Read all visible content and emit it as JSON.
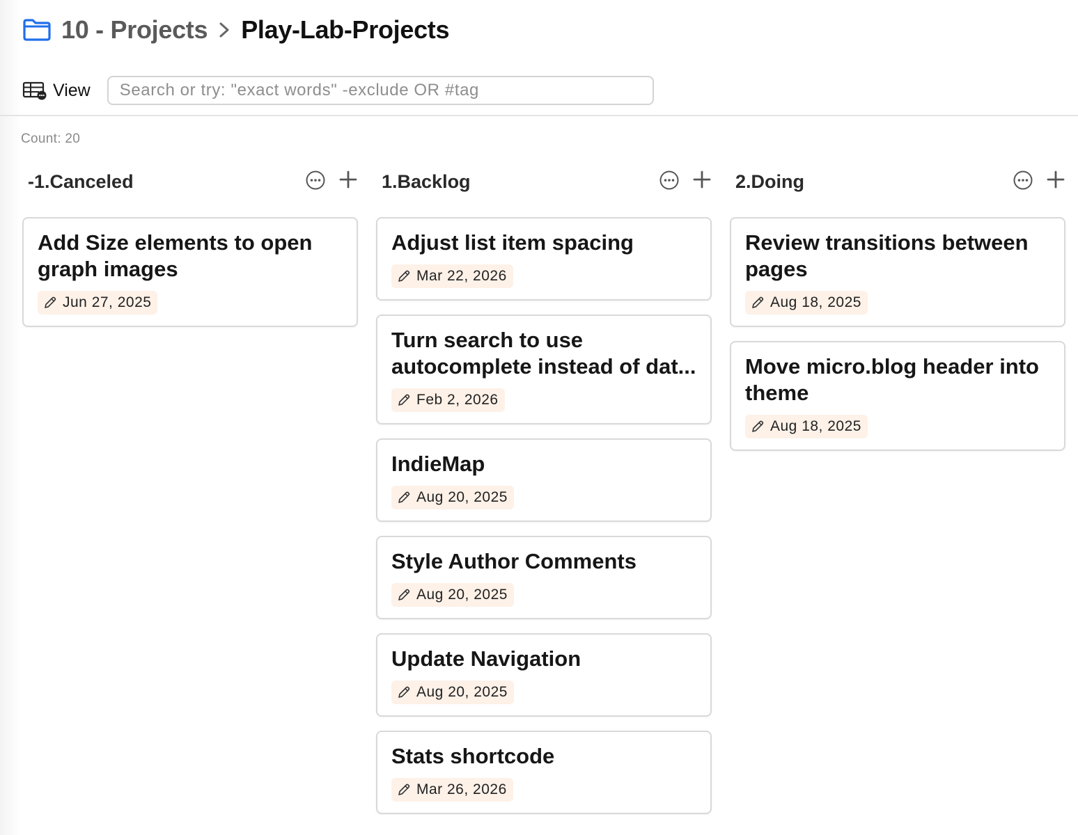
{
  "breadcrumb": {
    "parent": "10 - Projects",
    "current": "Play-Lab-Projects"
  },
  "toolbar": {
    "view_label": "View",
    "search_placeholder": "Search or try: \"exact words\" -exclude OR #tag",
    "search_value": ""
  },
  "count_label": "Count: 20",
  "colors": {
    "accent": "#1f6feb",
    "chip_bg": "#fdf1e8",
    "card_border": "#d9d9d9"
  },
  "columns": [
    {
      "title": "-1.Canceled",
      "cards": [
        {
          "title": "Add Size elements to open graph images",
          "date": "Jun 27, 2025"
        }
      ]
    },
    {
      "title": "1.Backlog",
      "cards": [
        {
          "title": "Adjust list item spacing",
          "date": "Mar 22, 2026"
        },
        {
          "title": "Turn search to use autocomplete instead of dat...",
          "date": "Feb 2, 2026"
        },
        {
          "title": "IndieMap",
          "date": "Aug 20, 2025"
        },
        {
          "title": "Style Author Comments",
          "date": "Aug 20, 2025"
        },
        {
          "title": "Update Navigation",
          "date": "Aug 20, 2025"
        },
        {
          "title": "Stats shortcode",
          "date": "Mar 26, 2026"
        }
      ]
    },
    {
      "title": "2.Doing",
      "cards": [
        {
          "title": "Review transitions between pages",
          "date": "Aug 18, 2025"
        },
        {
          "title": "Move micro.blog header into theme",
          "date": "Aug 18, 2025"
        }
      ]
    }
  ],
  "icons": {
    "folder": "folder-icon",
    "chevron": "chevron-right-icon",
    "view": "table-view-icon",
    "more": "more-icon",
    "add": "plus-icon",
    "edited": "pencil-icon"
  }
}
